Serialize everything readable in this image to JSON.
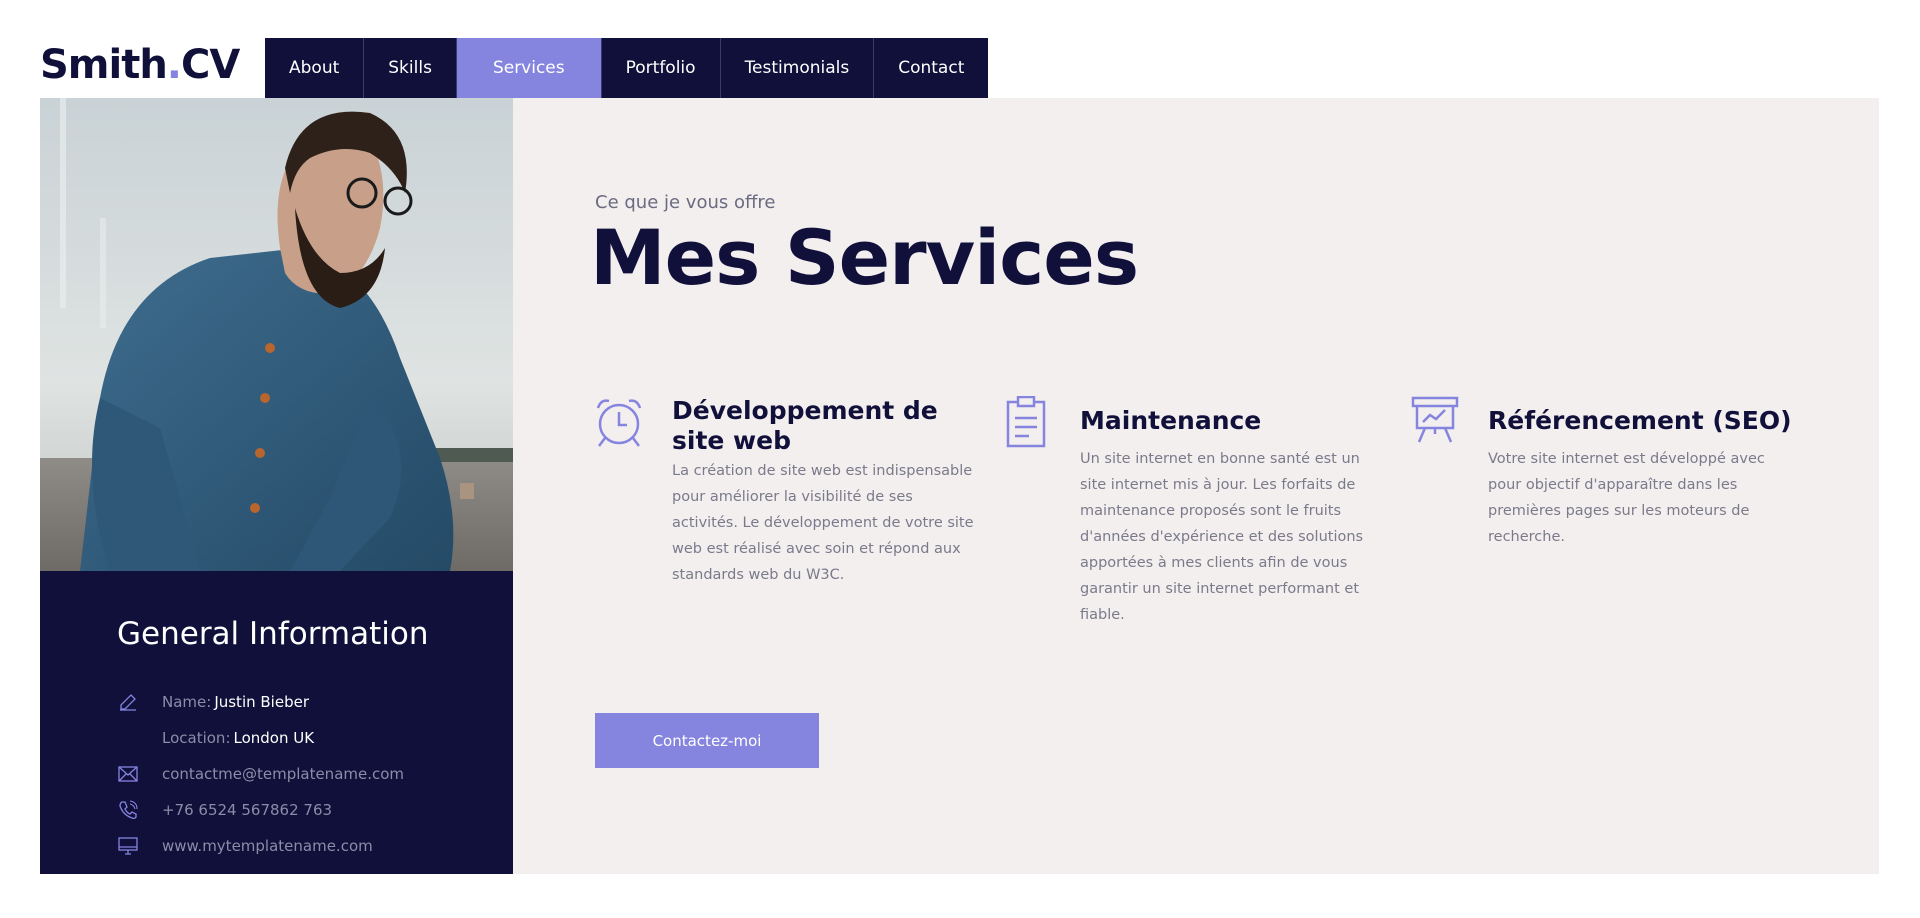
{
  "brand": {
    "name": "Smith",
    "dot": ".",
    "suffix": "CV"
  },
  "nav": {
    "items": [
      {
        "label": "About"
      },
      {
        "label": "Skills"
      },
      {
        "label": "Services"
      },
      {
        "label": "Portfolio"
      },
      {
        "label": "Testimonials"
      },
      {
        "label": "Contact"
      }
    ],
    "active": "Services"
  },
  "info": {
    "title": "General Information",
    "name_label": "Name:",
    "name_value": "Justin Bieber",
    "location_label": "Location:",
    "location_value": "London UK",
    "email": "contactme@templatename.com",
    "phone": "+76 6524 567862 763",
    "website": "www.mytemplatename.com"
  },
  "section": {
    "subtitle": "Ce que je vous offre",
    "title": "Mes Services"
  },
  "services": [
    {
      "icon": "alarm-clock-icon",
      "title": "Développement de site web",
      "text": "La création de site web est indispensable pour améliorer la visibilité de ses activités. Le développement de votre site web est réalisé avec soin et répond aux standards web du W3C."
    },
    {
      "icon": "clipboard-icon",
      "title": "Maintenance",
      "text": "Un site internet en bonne santé est un site internet mis à jour. Les forfaits de maintenance proposés sont le fruits d'années d'expérience et des solutions apportées à mes clients afin de vous garantir un site internet performant et fiable."
    },
    {
      "icon": "presentation-board-icon",
      "title": "Référencement (SEO)",
      "text": "Votre site internet est développé avec pour objectif d'apparaître dans les premières pages sur les moteurs de recherche."
    }
  ],
  "cta": {
    "label": "Contactez-moi"
  },
  "colors": {
    "navy": "#10103a",
    "accent": "#8585e0",
    "panel": "#f3efef"
  }
}
